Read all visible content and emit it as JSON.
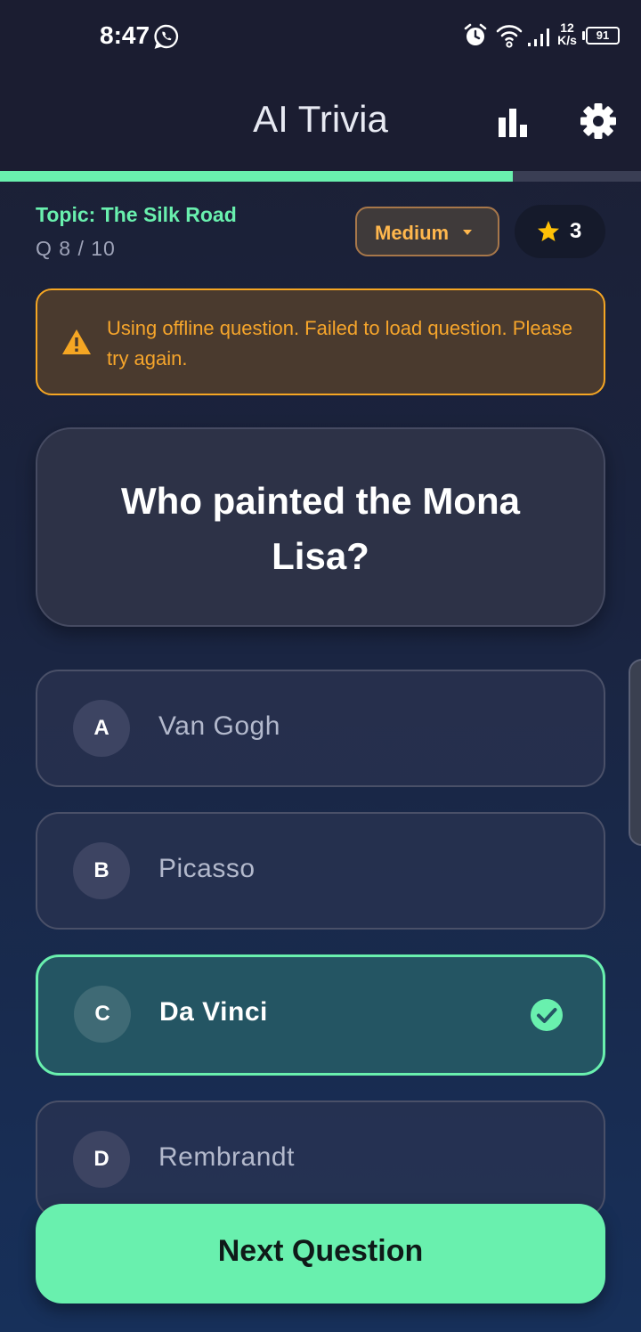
{
  "status_bar": {
    "time": "8:47",
    "net_speed_value": "12",
    "net_speed_unit": "K/s",
    "battery": "91",
    "icons": [
      "whatsapp-icon",
      "alarm-icon",
      "wifi-icon",
      "signal-icon",
      "battery-icon"
    ]
  },
  "app_bar": {
    "title": "AI Trivia",
    "icons": [
      "bar-chart-icon",
      "gear-icon"
    ]
  },
  "progress": {
    "current": 8,
    "total": 10,
    "fraction": 0.8,
    "color": "#69f0ae"
  },
  "quiz": {
    "topic": "Topic: The Silk Road",
    "question_counter": "Q 8 / 10",
    "difficulty": "Medium",
    "score": "3"
  },
  "banner": {
    "message": "Using offline question. Failed to load question. Please try again.",
    "icon": "warning-icon",
    "color": "#f5a623"
  },
  "question": {
    "text": "Who painted the Mona Lisa?",
    "options": [
      {
        "letter": "A",
        "text": "Van Gogh",
        "selected": false
      },
      {
        "letter": "B",
        "text": "Picasso",
        "selected": false
      },
      {
        "letter": "C",
        "text": "Da Vinci",
        "selected": true
      },
      {
        "letter": "D",
        "text": "Rembrandt",
        "selected": false
      }
    ]
  },
  "actions": {
    "next_label": "Next Question"
  },
  "colors": {
    "accent": "#69f0ae",
    "warning": "#f5a623",
    "difficulty": "#ffb74d",
    "background": "#1b1d31"
  }
}
